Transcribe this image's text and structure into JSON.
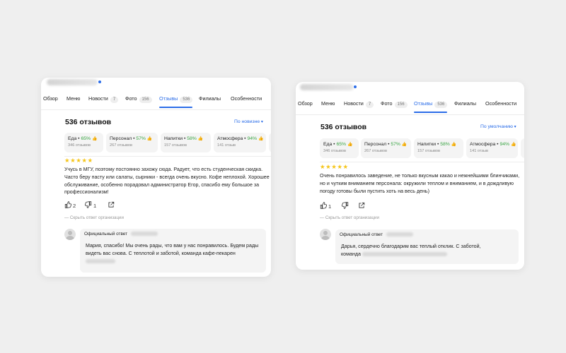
{
  "cards": [
    {
      "tabs": [
        {
          "label": "Обзор",
          "count": null
        },
        {
          "label": "Меню",
          "count": null
        },
        {
          "label": "Новости",
          "count": "7"
        },
        {
          "label": "Фото",
          "count": "156"
        },
        {
          "label": "Отзывы",
          "count": "536",
          "active": true
        },
        {
          "label": "Филиалы",
          "count": null
        },
        {
          "label": "Особенности",
          "count": null
        }
      ],
      "reviews_title": "536 отзывов",
      "sort_label": "По новизне",
      "chips": [
        {
          "name": "Еда",
          "pct": "65%",
          "sub": "346 отзывов"
        },
        {
          "name": "Персонал",
          "pct": "57%",
          "sub": "267 отзывов"
        },
        {
          "name": "Напитки",
          "pct": "58%",
          "sub": "157 отзывов"
        },
        {
          "name": "Атмосфера",
          "pct": "94%",
          "sub": "141 отзыв"
        }
      ],
      "stars": "★★★★★",
      "review_text": "Учусь в МГУ, поэтому постоянно захожу сюда. Радует, что есть студенческая скидка. Часто беру пасту или салаты, сырники - всегда очень вкусно. Кофе неплохой. Хорошее обслуживание, особенно порадовал администратор Егор, спасибо ему большое за профессионализм!",
      "likes": "2",
      "dislikes": "1",
      "hide_answer": "Скрыть ответ организации",
      "official_label": "Официальный ответ",
      "reply_text": "Мария, спасибо! Мы очень рады, что вам у нас понравилось. Будем рады видеть вас снова. С теплотой и заботой, команда кафе-пекарен"
    },
    {
      "tabs": [
        {
          "label": "Обзор",
          "count": null
        },
        {
          "label": "Меню",
          "count": null
        },
        {
          "label": "Новости",
          "count": "7"
        },
        {
          "label": "Фото",
          "count": "156"
        },
        {
          "label": "Отзывы",
          "count": "536",
          "active": true
        },
        {
          "label": "Филиалы",
          "count": null
        },
        {
          "label": "Особенности",
          "count": null
        }
      ],
      "reviews_title": "536 отзывов",
      "sort_label": "По умолчанию",
      "chips": [
        {
          "name": "Еда",
          "pct": "65%",
          "sub": "346 отзывов"
        },
        {
          "name": "Персонал",
          "pct": "57%",
          "sub": "267 отзывов"
        },
        {
          "name": "Напитки",
          "pct": "58%",
          "sub": "157 отзывов"
        },
        {
          "name": "Атмосфера",
          "pct": "94%",
          "sub": "141 отзыв"
        }
      ],
      "stars": "★★★★★",
      "review_text": "Очень понравилось заведение, не только вкусным какао и нежнейшими блинчиками, но и чутким вниманием персонала: окружили теплом и вниманием, и в дождливую погоду готовы были пустить хоть на весь день)",
      "likes": "1",
      "hide_answer": "Скрыть ответ организации",
      "official_label": "Официальный ответ",
      "reply_text_1": "Дарья, сердечно благодарим вас теплый отклик. С заботой,",
      "reply_text_2": "команда"
    }
  ],
  "colors": {
    "accent": "#2b6de8",
    "positive": "#3aa544",
    "star": "#f5c518",
    "background": "#efefef"
  }
}
